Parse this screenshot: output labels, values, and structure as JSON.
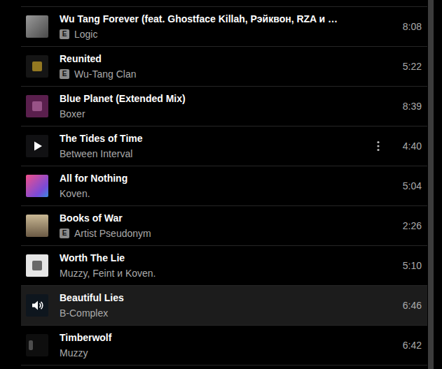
{
  "explicit_badge": "E",
  "tracks": [
    {
      "title": "Wu Tang Forever (feat. Ghostface Killah, Рэйквон, RZA и …",
      "artist": "Logic",
      "duration": "8:08",
      "explicit": true,
      "hovered": false,
      "playing": false
    },
    {
      "title": "Reunited",
      "artist": "Wu-Tang Clan",
      "duration": "5:22",
      "explicit": true,
      "hovered": false,
      "playing": false
    },
    {
      "title": "Blue Planet (Extended Mix)",
      "artist": "Boxer",
      "duration": "8:39",
      "explicit": false,
      "hovered": false,
      "playing": false
    },
    {
      "title": "The Tides of Time",
      "artist": "Between Interval",
      "duration": "4:40",
      "explicit": false,
      "hovered": true,
      "playing": false
    },
    {
      "title": "All for Nothing",
      "artist": "Koven.",
      "duration": "5:04",
      "explicit": false,
      "hovered": false,
      "playing": false
    },
    {
      "title": "Books of War",
      "artist": "Artist Pseudonym",
      "duration": "2:26",
      "explicit": true,
      "hovered": false,
      "playing": false
    },
    {
      "title": "Worth The Lie",
      "artist": "Muzzy, Feint и Koven.",
      "duration": "5:10",
      "explicit": false,
      "hovered": false,
      "playing": false
    },
    {
      "title": "Beautiful Lies",
      "artist": "B-Complex",
      "duration": "6:46",
      "explicit": false,
      "hovered": false,
      "playing": true
    },
    {
      "title": "Timberwolf",
      "artist": "Muzzy",
      "duration": "6:42",
      "explicit": false,
      "hovered": false,
      "playing": false
    }
  ]
}
